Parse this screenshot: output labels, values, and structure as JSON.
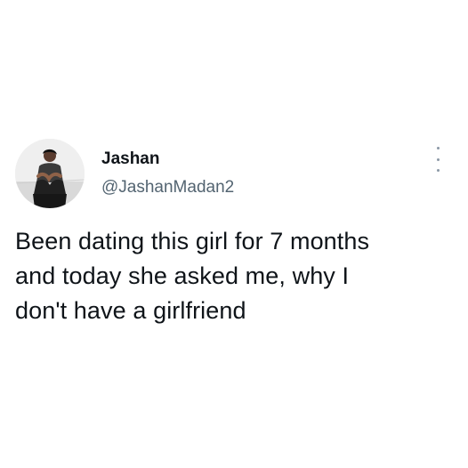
{
  "author": {
    "display_name": "Jashan",
    "handle": "@JashanMadan2",
    "avatar_icon": "profile-photo"
  },
  "tweet": {
    "lines": [
      "Been dating this girl for 7 months",
      "and today she asked me, why I",
      "don't have a girlfriend"
    ]
  },
  "actions": {
    "more_icon": "more-options-icon"
  },
  "colors": {
    "text_primary": "#0f1419",
    "text_secondary": "#536471",
    "icon_muted": "#8b98a5",
    "background": "#ffffff"
  }
}
